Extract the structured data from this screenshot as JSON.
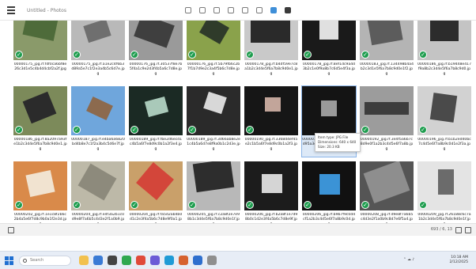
{
  "window": {
    "title": "Untitled - Photos",
    "toolbar_icons": [
      "menu-icon",
      "crop-icon",
      "rotate-icon",
      "zoom-icon",
      "filter-icon",
      "info-icon",
      "folder-icon",
      "share-icon",
      "more-icon"
    ]
  },
  "files": [
    "00000175_jpg.rf.f4f0ca6bf8e26c3d1e5c4b4d4cbf2a2f.jpg",
    "00000175_jpg.rf.a1e2c4f6b3d89a5e7c1f2e3a4b5c6d7e.jpg",
    "00000176_jpg.rf.30537f8e7b5f4a1c9e2d3f4b5a6c7d8e.jpg",
    "00000176_jpg.rf.5b79fb6c2b7f1b7d9e2c3a4f5b6c7d8e.jpg",
    "00000178_jpg.rf.b4df59e7c8a1b2c3d4e5f6a7b8c9d0e1.jpg",
    "00000178_jpg.rf.8ef1dc9a4d3b2c1e0f9a8b7c6d5e4f3a.jpg",
    "00000183_jpg.rf.134498b4a4b2c3d1e5f6a7b8c9d0e1f2.jpg",
    "00000186_jpg.rf.b19448e417f9a8b2c3d4e5f6a7b8c9d0.jpg",
    "00000186_jpg.rf.8a2097a93fe1b2c3d4e5f6a7b8c9d0e1.jpg",
    "00000187_jpg.rf.e4ba6a6820bd4b8e7c1f2a3b4c5d6e7f.jpg",
    "00000189_jpg.rf.fbe2d6ecd1c4b5a6f7e8d9c0b1a2f3e4.jpg",
    "00000189_jpg.rf.3d66ab8e2e1c4b5a6d7e8f9a0b1c2d3e.jpg",
    "00000190_jpg.rf.3368d4ef45e2c1b5a6f7e8d9c0b1a2f3.jpg",
    "00000191_jpg.rf.44217d42c8d95a3e7f6b1c2d3e4f5a6b.jpg",
    "00000192_jpg.rf.3e4f5a6b7c8d9e0f1a2b3c4d5e6f7a8b.jpg",
    "00000196_jpg.rf.b1b2ed40bc7c4d5e6f7a8b9c0d1e2f3a.jpg",
    "00000202_jpg.rf.1e1c8f2b6c2b4a5e6f7d8c9b0a1f2e3d.jpg",
    "00000204_jpg.rf.e4f3a2b1c0d9e8f7a6b5c4d3e2f1a0b9.jpg",
    "00000204_jpg.rf.fa5d2ab4b0d1c2e3f4a5b6c7d8e9f0a1.jpg",
    "00000205_jpg.rf.c2a8f2e7e98b1c3d4e5f6a7b8c9d0e1f.jpg",
    "00000206_jpg.rf.b2a8f1e7d98b0c1d2e3f4a5b6c7d8e9f.jpg",
    "00000206_jpg.rf.b9b7f9c0d4cf1a2b3c4d5e6f7a8b9c0d.jpg",
    "00000208_jpg.rf.d9e8f7a6b5c4d3e2f1a0b9c8d7e6f5a4.jpg",
    "00000209_jpg.rf.26188c6c7a1b2c3d4e5f6a7b8c9d0e1f.jpg"
  ],
  "tooltip": {
    "line1": "Item type: JPG File",
    "line2": "Dimensions: 640 x 640",
    "line3": "Size: 20.3 KB"
  },
  "statusbar": {
    "right_text": "693 / 6, 13"
  },
  "taskbar": {
    "search_placeholder": "Search",
    "time": "10:18 AM",
    "date": "2/12/2025"
  }
}
